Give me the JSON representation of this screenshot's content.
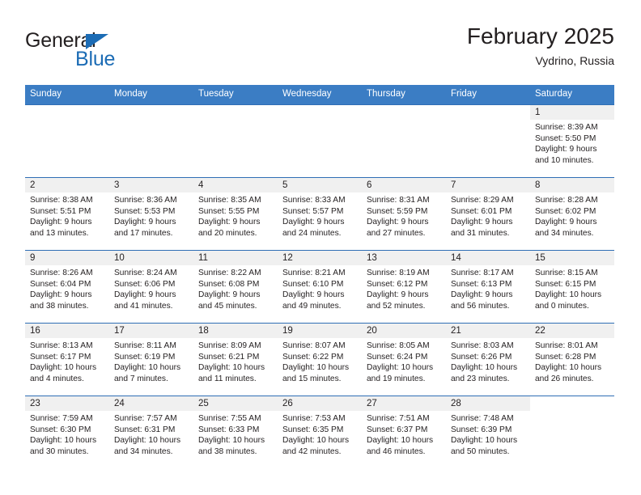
{
  "brand": {
    "name_part1": "General",
    "name_part2": "Blue",
    "accent_color": "#1c6cb5"
  },
  "header": {
    "title": "February 2025",
    "subtitle": "Vydrino, Russia"
  },
  "theme": {
    "header_bg": "#3b7dc4",
    "row_rule": "#2f6eb5",
    "numband_bg": "#f0f0f0",
    "text": "#231f20"
  },
  "weekdays": [
    "Sunday",
    "Monday",
    "Tuesday",
    "Wednesday",
    "Thursday",
    "Friday",
    "Saturday"
  ],
  "weeks": [
    [
      {
        "day": "",
        "sunrise": "",
        "sunset": "",
        "daylight": "",
        "empty": true
      },
      {
        "day": "",
        "sunrise": "",
        "sunset": "",
        "daylight": "",
        "empty": true
      },
      {
        "day": "",
        "sunrise": "",
        "sunset": "",
        "daylight": "",
        "empty": true
      },
      {
        "day": "",
        "sunrise": "",
        "sunset": "",
        "daylight": "",
        "empty": true
      },
      {
        "day": "",
        "sunrise": "",
        "sunset": "",
        "daylight": "",
        "empty": true
      },
      {
        "day": "",
        "sunrise": "",
        "sunset": "",
        "daylight": "",
        "empty": true
      },
      {
        "day": "1",
        "sunrise": "Sunrise: 8:39 AM",
        "sunset": "Sunset: 5:50 PM",
        "daylight": "Daylight: 9 hours and 10 minutes.",
        "empty": false
      }
    ],
    [
      {
        "day": "2",
        "sunrise": "Sunrise: 8:38 AM",
        "sunset": "Sunset: 5:51 PM",
        "daylight": "Daylight: 9 hours and 13 minutes.",
        "empty": false
      },
      {
        "day": "3",
        "sunrise": "Sunrise: 8:36 AM",
        "sunset": "Sunset: 5:53 PM",
        "daylight": "Daylight: 9 hours and 17 minutes.",
        "empty": false
      },
      {
        "day": "4",
        "sunrise": "Sunrise: 8:35 AM",
        "sunset": "Sunset: 5:55 PM",
        "daylight": "Daylight: 9 hours and 20 minutes.",
        "empty": false
      },
      {
        "day": "5",
        "sunrise": "Sunrise: 8:33 AM",
        "sunset": "Sunset: 5:57 PM",
        "daylight": "Daylight: 9 hours and 24 minutes.",
        "empty": false
      },
      {
        "day": "6",
        "sunrise": "Sunrise: 8:31 AM",
        "sunset": "Sunset: 5:59 PM",
        "daylight": "Daylight: 9 hours and 27 minutes.",
        "empty": false
      },
      {
        "day": "7",
        "sunrise": "Sunrise: 8:29 AM",
        "sunset": "Sunset: 6:01 PM",
        "daylight": "Daylight: 9 hours and 31 minutes.",
        "empty": false
      },
      {
        "day": "8",
        "sunrise": "Sunrise: 8:28 AM",
        "sunset": "Sunset: 6:02 PM",
        "daylight": "Daylight: 9 hours and 34 minutes.",
        "empty": false
      }
    ],
    [
      {
        "day": "9",
        "sunrise": "Sunrise: 8:26 AM",
        "sunset": "Sunset: 6:04 PM",
        "daylight": "Daylight: 9 hours and 38 minutes.",
        "empty": false
      },
      {
        "day": "10",
        "sunrise": "Sunrise: 8:24 AM",
        "sunset": "Sunset: 6:06 PM",
        "daylight": "Daylight: 9 hours and 41 minutes.",
        "empty": false
      },
      {
        "day": "11",
        "sunrise": "Sunrise: 8:22 AM",
        "sunset": "Sunset: 6:08 PM",
        "daylight": "Daylight: 9 hours and 45 minutes.",
        "empty": false
      },
      {
        "day": "12",
        "sunrise": "Sunrise: 8:21 AM",
        "sunset": "Sunset: 6:10 PM",
        "daylight": "Daylight: 9 hours and 49 minutes.",
        "empty": false
      },
      {
        "day": "13",
        "sunrise": "Sunrise: 8:19 AM",
        "sunset": "Sunset: 6:12 PM",
        "daylight": "Daylight: 9 hours and 52 minutes.",
        "empty": false
      },
      {
        "day": "14",
        "sunrise": "Sunrise: 8:17 AM",
        "sunset": "Sunset: 6:13 PM",
        "daylight": "Daylight: 9 hours and 56 minutes.",
        "empty": false
      },
      {
        "day": "15",
        "sunrise": "Sunrise: 8:15 AM",
        "sunset": "Sunset: 6:15 PM",
        "daylight": "Daylight: 10 hours and 0 minutes.",
        "empty": false
      }
    ],
    [
      {
        "day": "16",
        "sunrise": "Sunrise: 8:13 AM",
        "sunset": "Sunset: 6:17 PM",
        "daylight": "Daylight: 10 hours and 4 minutes.",
        "empty": false
      },
      {
        "day": "17",
        "sunrise": "Sunrise: 8:11 AM",
        "sunset": "Sunset: 6:19 PM",
        "daylight": "Daylight: 10 hours and 7 minutes.",
        "empty": false
      },
      {
        "day": "18",
        "sunrise": "Sunrise: 8:09 AM",
        "sunset": "Sunset: 6:21 PM",
        "daylight": "Daylight: 10 hours and 11 minutes.",
        "empty": false
      },
      {
        "day": "19",
        "sunrise": "Sunrise: 8:07 AM",
        "sunset": "Sunset: 6:22 PM",
        "daylight": "Daylight: 10 hours and 15 minutes.",
        "empty": false
      },
      {
        "day": "20",
        "sunrise": "Sunrise: 8:05 AM",
        "sunset": "Sunset: 6:24 PM",
        "daylight": "Daylight: 10 hours and 19 minutes.",
        "empty": false
      },
      {
        "day": "21",
        "sunrise": "Sunrise: 8:03 AM",
        "sunset": "Sunset: 6:26 PM",
        "daylight": "Daylight: 10 hours and 23 minutes.",
        "empty": false
      },
      {
        "day": "22",
        "sunrise": "Sunrise: 8:01 AM",
        "sunset": "Sunset: 6:28 PM",
        "daylight": "Daylight: 10 hours and 26 minutes.",
        "empty": false
      }
    ],
    [
      {
        "day": "23",
        "sunrise": "Sunrise: 7:59 AM",
        "sunset": "Sunset: 6:30 PM",
        "daylight": "Daylight: 10 hours and 30 minutes.",
        "empty": false
      },
      {
        "day": "24",
        "sunrise": "Sunrise: 7:57 AM",
        "sunset": "Sunset: 6:31 PM",
        "daylight": "Daylight: 10 hours and 34 minutes.",
        "empty": false
      },
      {
        "day": "25",
        "sunrise": "Sunrise: 7:55 AM",
        "sunset": "Sunset: 6:33 PM",
        "daylight": "Daylight: 10 hours and 38 minutes.",
        "empty": false
      },
      {
        "day": "26",
        "sunrise": "Sunrise: 7:53 AM",
        "sunset": "Sunset: 6:35 PM",
        "daylight": "Daylight: 10 hours and 42 minutes.",
        "empty": false
      },
      {
        "day": "27",
        "sunrise": "Sunrise: 7:51 AM",
        "sunset": "Sunset: 6:37 PM",
        "daylight": "Daylight: 10 hours and 46 minutes.",
        "empty": false
      },
      {
        "day": "28",
        "sunrise": "Sunrise: 7:48 AM",
        "sunset": "Sunset: 6:39 PM",
        "daylight": "Daylight: 10 hours and 50 minutes.",
        "empty": false
      },
      {
        "day": "",
        "sunrise": "",
        "sunset": "",
        "daylight": "",
        "empty": true
      }
    ]
  ]
}
